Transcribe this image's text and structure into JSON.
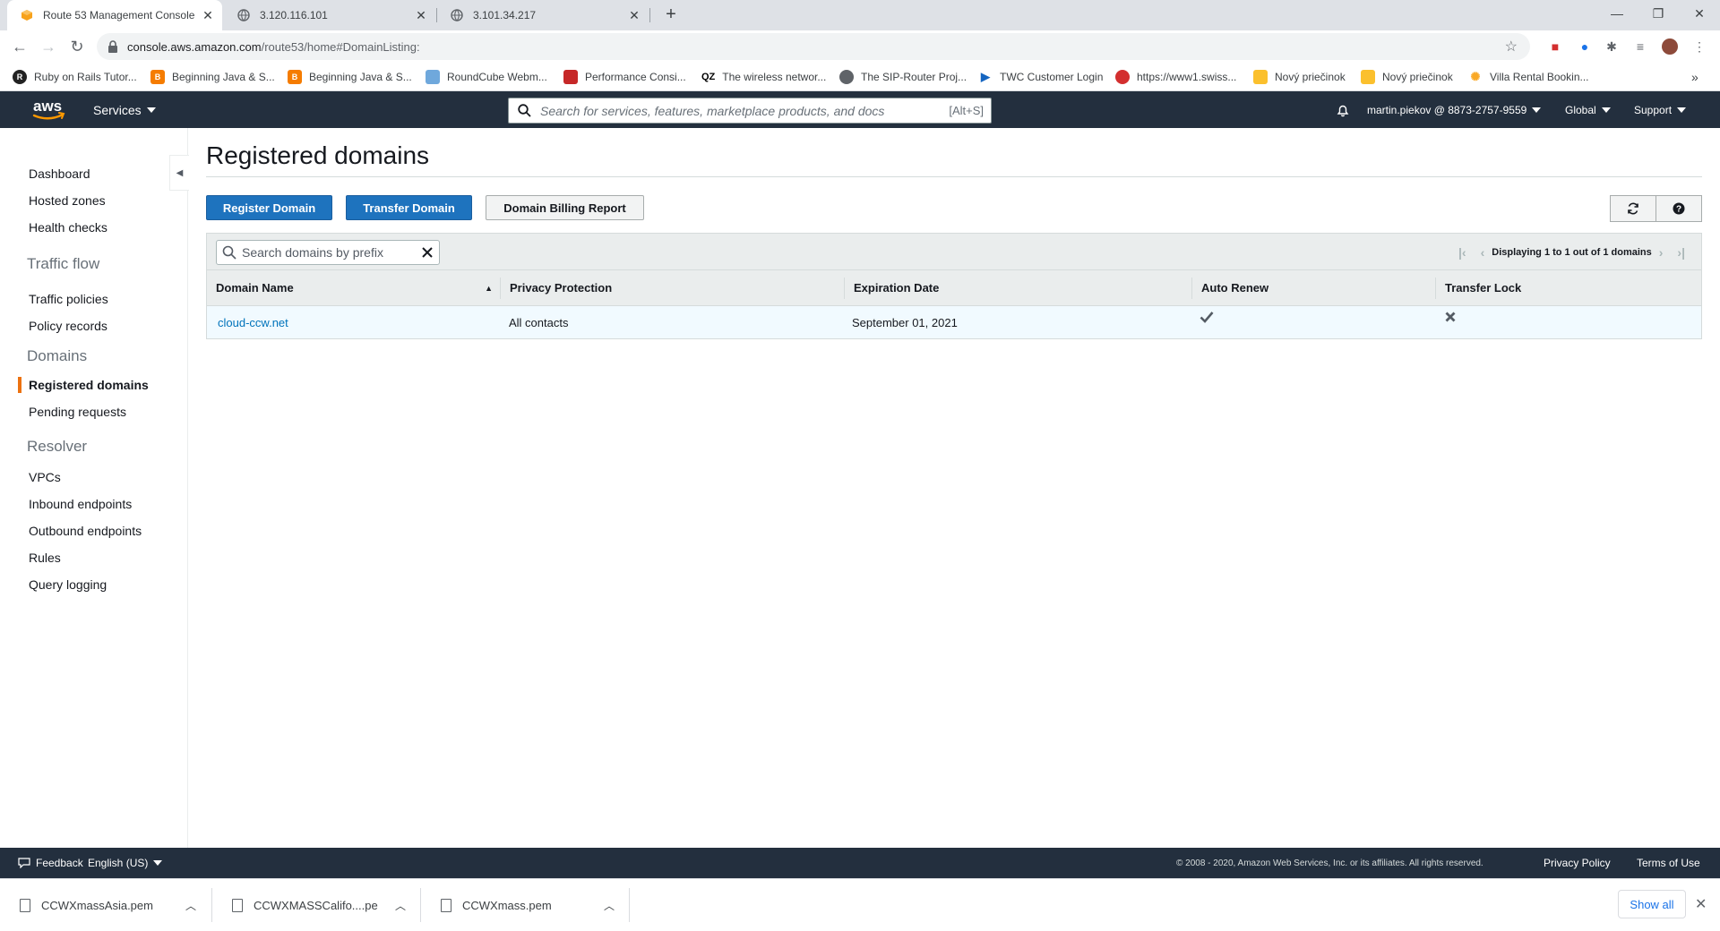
{
  "browser": {
    "tabs": [
      {
        "title": "Route 53 Management Console",
        "active": true
      },
      {
        "title": "3.120.116.101",
        "active": false
      },
      {
        "title": "3.101.34.217",
        "active": false
      }
    ],
    "url_host": "console.aws.amazon.com",
    "url_path": "/route53/home#DomainListing:",
    "bookmarks": [
      {
        "label": "Ruby on Rails Tutor...",
        "color": "#222222"
      },
      {
        "label": "Beginning Java & S...",
        "color": "#f57c00"
      },
      {
        "label": "Beginning Java & S...",
        "color": "#f57c00"
      },
      {
        "label": "RoundCube Webm...",
        "color": "#6fa8dc"
      },
      {
        "label": "Performance Consi...",
        "color": "#c62828"
      },
      {
        "label": "The wireless networ...",
        "color": "#000000"
      },
      {
        "label": "The SIP-Router Proj...",
        "color": "#5f6368"
      },
      {
        "label": "TWC Customer Login",
        "color": "#1565c0"
      },
      {
        "label": "https://www1.swiss...",
        "color": "#d32f2f"
      },
      {
        "label": "Nový priečinok",
        "color": "#fbc02d"
      },
      {
        "label": "Nový priečinok",
        "color": "#fbc02d"
      },
      {
        "label": "Villa Rental Bookin...",
        "color": "#f9a825"
      }
    ],
    "qz_text": "QZ"
  },
  "aws_header": {
    "logo_text": "aws",
    "services_label": "Services",
    "search_placeholder": "Search for services, features, marketplace products, and docs",
    "search_shortcut": "[Alt+S]",
    "account": "martin.piekov @ 8873-2757-9559",
    "region": "Global",
    "support": "Support"
  },
  "sidebar": {
    "top_items": [
      "Dashboard",
      "Hosted zones",
      "Health checks"
    ],
    "traffic_flow": {
      "title": "Traffic flow",
      "items": [
        "Traffic policies",
        "Policy records"
      ]
    },
    "domains": {
      "title": "Domains",
      "items": [
        "Registered domains",
        "Pending requests"
      ],
      "active": "Registered domains"
    },
    "resolver": {
      "title": "Resolver",
      "items": [
        "VPCs",
        "Inbound endpoints",
        "Outbound endpoints",
        "Rules",
        "Query logging"
      ]
    }
  },
  "main": {
    "title": "Registered domains",
    "buttons": {
      "register": "Register Domain",
      "transfer": "Transfer Domain",
      "billing": "Domain Billing Report"
    },
    "search_placeholder": "Search domains by prefix",
    "pager_text": "Displaying 1 to 1 out of 1 domains",
    "columns": [
      "Domain Name",
      "Privacy Protection",
      "Expiration Date",
      "Auto Renew",
      "Transfer Lock"
    ],
    "rows": [
      {
        "domain": "cloud-ccw.net",
        "privacy": "All contacts",
        "expiration": "September 01, 2021",
        "auto_renew": true,
        "transfer_lock": false
      }
    ]
  },
  "footer": {
    "feedback": "Feedback",
    "language": "English (US)",
    "copyright": "© 2008 - 2020, Amazon Web Services, Inc. or its affiliates. All rights reserved.",
    "privacy": "Privacy Policy",
    "terms": "Terms of Use"
  },
  "downloads": {
    "files": [
      "CCWXmassAsia.pem",
      "CCWXMASSCalifo....pe",
      "CCWXmass.pem"
    ],
    "show_all": "Show all"
  },
  "colors": {
    "aws_nav": "#232f3e",
    "primary_button": "#1e73be",
    "active_accent": "#ec7211",
    "link": "#0073bb"
  }
}
